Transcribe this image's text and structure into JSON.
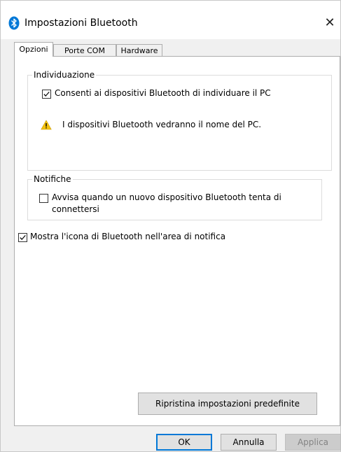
{
  "window": {
    "title": "Impostazioni Bluetooth",
    "close_glyph": "✕",
    "icon": "bluetooth-icon"
  },
  "tabs": [
    {
      "label": "Opzioni",
      "active": true
    },
    {
      "label": "Porte COM",
      "active": false
    },
    {
      "label": "Hardware",
      "active": false
    }
  ],
  "individuazione": {
    "legend": "Individuazione",
    "allow_discovery": {
      "label": "Consenti ai dispositivi Bluetooth di individuare il PC",
      "checked": true
    },
    "warning": {
      "icon": "warning-icon",
      "text": "I dispositivi Bluetooth vedranno il nome del PC."
    }
  },
  "notifiche": {
    "legend": "Notifiche",
    "alert_new_device": {
      "label": "Avvisa quando un nuovo dispositivo Bluetooth tenta di connettersi",
      "checked": false
    }
  },
  "show_icon": {
    "label": "Mostra l'icona di Bluetooth nell'area di notifica",
    "checked": true
  },
  "buttons": {
    "restore_defaults": "Ripristina impostazioni predefinite",
    "ok": "OK",
    "cancel": "Annulla",
    "apply": "Applica"
  },
  "colors": {
    "bluetooth_blue": "#0078d7",
    "warning_yellow": "#f4c20d",
    "default_button_border": "#0078d7"
  }
}
